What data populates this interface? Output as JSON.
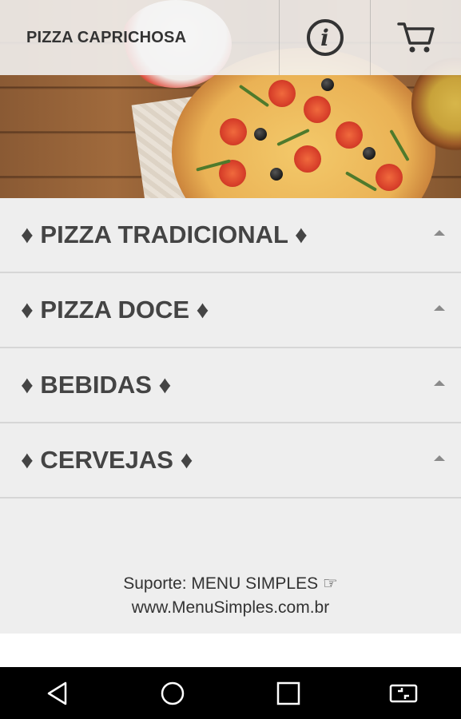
{
  "app_bar": {
    "title": "PIZZA CAPRICHOSA",
    "info_icon": "info-icon",
    "cart_icon": "cart-icon"
  },
  "categories": [
    {
      "label": "♦ PIZZA TRADICIONAL ♦",
      "expand_icon": "chevron-up-icon"
    },
    {
      "label": "♦ PIZZA DOCE ♦",
      "expand_icon": "chevron-up-icon"
    },
    {
      "label": "♦ BEBIDAS ♦",
      "expand_icon": "chevron-up-icon"
    },
    {
      "label": "♦ CERVEJAS ♦",
      "expand_icon": "chevron-up-icon"
    }
  ],
  "footer": {
    "support_line": "Suporte: MENU SIMPLES ☞",
    "url_line": "www.MenuSimples.com.br"
  },
  "system_nav": {
    "back_icon": "back-icon",
    "home_icon": "home-icon",
    "recents_icon": "recents-icon",
    "extra_icon": "screen-mirror-icon"
  }
}
